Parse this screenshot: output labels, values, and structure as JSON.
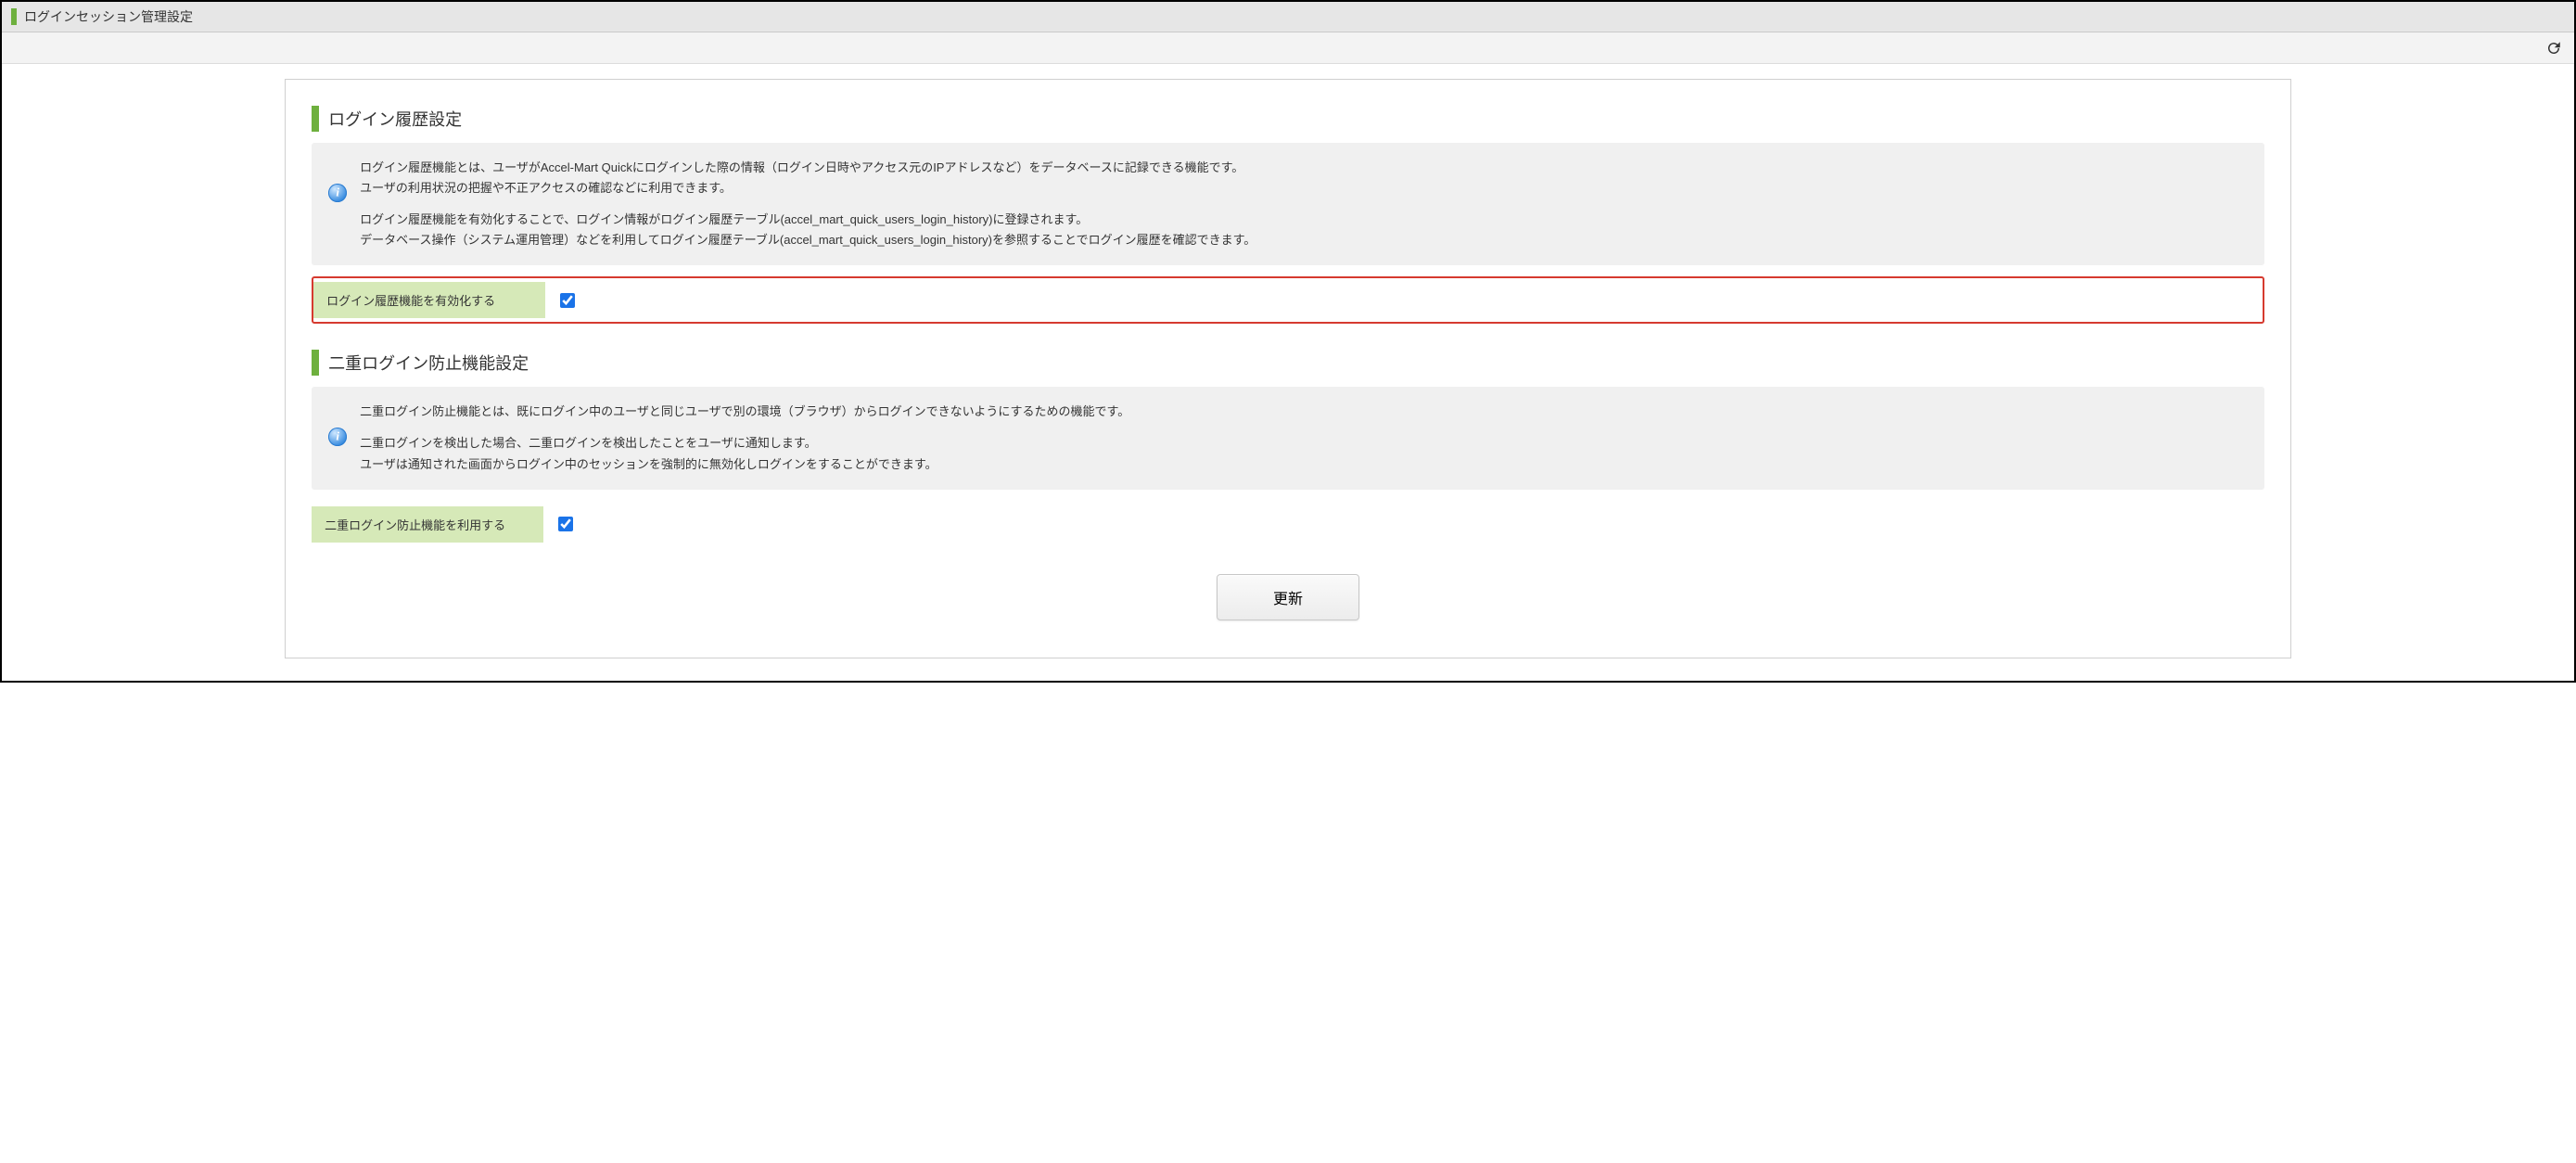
{
  "header": {
    "title": "ログインセッション管理設定"
  },
  "toolbar": {
    "reload_icon": "reload"
  },
  "sections": {
    "login_history": {
      "title": "ログイン履歴設定",
      "info_para1": "ログイン履歴機能とは、ユーザがAccel-Mart Quickにログインした際の情報（ログイン日時やアクセス元のIPアドレスなど）をデータベースに記録できる機能です。\nユーザの利用状況の把握や不正アクセスの確認などに利用できます。",
      "info_para2": "ログイン履歴機能を有効化することで、ログイン情報がログイン履歴テーブル(accel_mart_quick_users_login_history)に登録されます。\nデータベース操作（システム運用管理）などを利用してログイン履歴テーブル(accel_mart_quick_users_login_history)を参照することでログイン履歴を確認できます。",
      "field_label": "ログイン履歴機能を有効化する",
      "enabled": true
    },
    "double_login": {
      "title": "二重ログイン防止機能設定",
      "info_para1": "二重ログイン防止機能とは、既にログイン中のユーザと同じユーザで別の環境（ブラウザ）からログインできないようにするための機能です。",
      "info_para2": "二重ログインを検出した場合、二重ログインを検出したことをユーザに通知します。\nユーザは通知された画面からログイン中のセッションを強制的に無効化しログインをすることができます。",
      "field_label": "二重ログイン防止機能を利用する",
      "enabled": true
    }
  },
  "buttons": {
    "update": "更新"
  }
}
